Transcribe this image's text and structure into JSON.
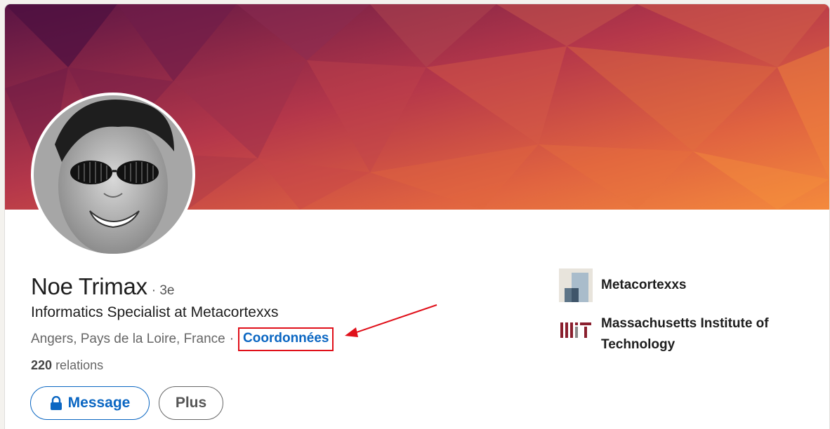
{
  "profile": {
    "name": "Noe Trimax",
    "degree": "· 3e",
    "headline": "Informatics Specialist at Metacortexxs",
    "location": "Angers, Pays de la Loire, France",
    "separator": "·",
    "contact_label": "Coordonnées",
    "connections_count": "220",
    "connections_label": "relations"
  },
  "actions": {
    "message_label": "Message",
    "more_label": "Plus"
  },
  "experience": {
    "company": "Metacortexxs",
    "school": "Massachusetts Institute of Technology"
  },
  "colors": {
    "accent": "#0a66c2",
    "highlight": "#e0101a",
    "mit_red": "#8a1f2e"
  }
}
